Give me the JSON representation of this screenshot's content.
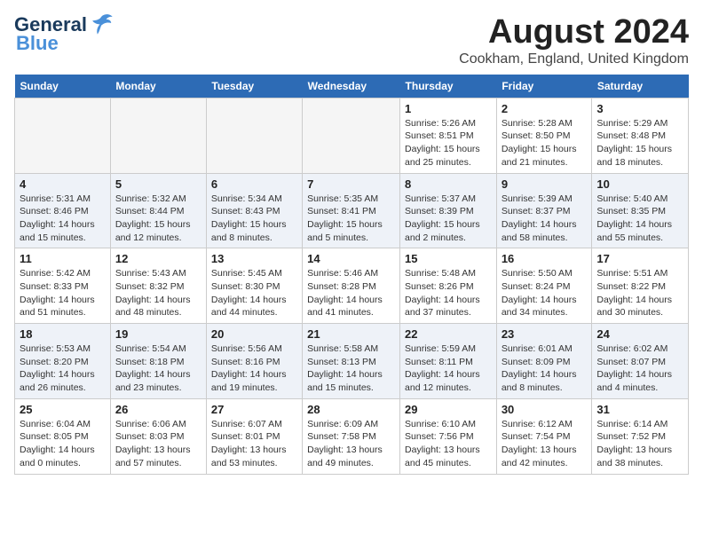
{
  "header": {
    "logo_general": "General",
    "logo_blue": "Blue",
    "month_year": "August 2024",
    "location": "Cookham, England, United Kingdom"
  },
  "days_of_week": [
    "Sunday",
    "Monday",
    "Tuesday",
    "Wednesday",
    "Thursday",
    "Friday",
    "Saturday"
  ],
  "weeks": [
    [
      {
        "day": "",
        "empty": true
      },
      {
        "day": "",
        "empty": true
      },
      {
        "day": "",
        "empty": true
      },
      {
        "day": "",
        "empty": true
      },
      {
        "day": "1",
        "sunrise": "5:26 AM",
        "sunset": "8:51 PM",
        "daylight": "15 hours and 25 minutes."
      },
      {
        "day": "2",
        "sunrise": "5:28 AM",
        "sunset": "8:50 PM",
        "daylight": "15 hours and 21 minutes."
      },
      {
        "day": "3",
        "sunrise": "5:29 AM",
        "sunset": "8:48 PM",
        "daylight": "15 hours and 18 minutes."
      }
    ],
    [
      {
        "day": "4",
        "sunrise": "5:31 AM",
        "sunset": "8:46 PM",
        "daylight": "14 hours and 15 minutes."
      },
      {
        "day": "5",
        "sunrise": "5:32 AM",
        "sunset": "8:44 PM",
        "daylight": "15 hours and 12 minutes."
      },
      {
        "day": "6",
        "sunrise": "5:34 AM",
        "sunset": "8:43 PM",
        "daylight": "15 hours and 8 minutes."
      },
      {
        "day": "7",
        "sunrise": "5:35 AM",
        "sunset": "8:41 PM",
        "daylight": "15 hours and 5 minutes."
      },
      {
        "day": "8",
        "sunrise": "5:37 AM",
        "sunset": "8:39 PM",
        "daylight": "15 hours and 2 minutes."
      },
      {
        "day": "9",
        "sunrise": "5:39 AM",
        "sunset": "8:37 PM",
        "daylight": "14 hours and 58 minutes."
      },
      {
        "day": "10",
        "sunrise": "5:40 AM",
        "sunset": "8:35 PM",
        "daylight": "14 hours and 55 minutes."
      }
    ],
    [
      {
        "day": "11",
        "sunrise": "5:42 AM",
        "sunset": "8:33 PM",
        "daylight": "14 hours and 51 minutes."
      },
      {
        "day": "12",
        "sunrise": "5:43 AM",
        "sunset": "8:32 PM",
        "daylight": "14 hours and 48 minutes."
      },
      {
        "day": "13",
        "sunrise": "5:45 AM",
        "sunset": "8:30 PM",
        "daylight": "14 hours and 44 minutes."
      },
      {
        "day": "14",
        "sunrise": "5:46 AM",
        "sunset": "8:28 PM",
        "daylight": "14 hours and 41 minutes."
      },
      {
        "day": "15",
        "sunrise": "5:48 AM",
        "sunset": "8:26 PM",
        "daylight": "14 hours and 37 minutes."
      },
      {
        "day": "16",
        "sunrise": "5:50 AM",
        "sunset": "8:24 PM",
        "daylight": "14 hours and 34 minutes."
      },
      {
        "day": "17",
        "sunrise": "5:51 AM",
        "sunset": "8:22 PM",
        "daylight": "14 hours and 30 minutes."
      }
    ],
    [
      {
        "day": "18",
        "sunrise": "5:53 AM",
        "sunset": "8:20 PM",
        "daylight": "14 hours and 26 minutes."
      },
      {
        "day": "19",
        "sunrise": "5:54 AM",
        "sunset": "8:18 PM",
        "daylight": "14 hours and 23 minutes."
      },
      {
        "day": "20",
        "sunrise": "5:56 AM",
        "sunset": "8:16 PM",
        "daylight": "14 hours and 19 minutes."
      },
      {
        "day": "21",
        "sunrise": "5:58 AM",
        "sunset": "8:13 PM",
        "daylight": "14 hours and 15 minutes."
      },
      {
        "day": "22",
        "sunrise": "5:59 AM",
        "sunset": "8:11 PM",
        "daylight": "14 hours and 12 minutes."
      },
      {
        "day": "23",
        "sunrise": "6:01 AM",
        "sunset": "8:09 PM",
        "daylight": "14 hours and 8 minutes."
      },
      {
        "day": "24",
        "sunrise": "6:02 AM",
        "sunset": "8:07 PM",
        "daylight": "14 hours and 4 minutes."
      }
    ],
    [
      {
        "day": "25",
        "sunrise": "6:04 AM",
        "sunset": "8:05 PM",
        "daylight": "14 hours and 0 minutes."
      },
      {
        "day": "26",
        "sunrise": "6:06 AM",
        "sunset": "8:03 PM",
        "daylight": "13 hours and 57 minutes."
      },
      {
        "day": "27",
        "sunrise": "6:07 AM",
        "sunset": "8:01 PM",
        "daylight": "13 hours and 53 minutes."
      },
      {
        "day": "28",
        "sunrise": "6:09 AM",
        "sunset": "7:58 PM",
        "daylight": "13 hours and 49 minutes."
      },
      {
        "day": "29",
        "sunrise": "6:10 AM",
        "sunset": "7:56 PM",
        "daylight": "13 hours and 45 minutes."
      },
      {
        "day": "30",
        "sunrise": "6:12 AM",
        "sunset": "7:54 PM",
        "daylight": "13 hours and 42 minutes."
      },
      {
        "day": "31",
        "sunrise": "6:14 AM",
        "sunset": "7:52 PM",
        "daylight": "13 hours and 38 minutes."
      }
    ]
  ],
  "labels": {
    "sunrise": "Sunrise:",
    "sunset": "Sunset:",
    "daylight": "Daylight:"
  }
}
